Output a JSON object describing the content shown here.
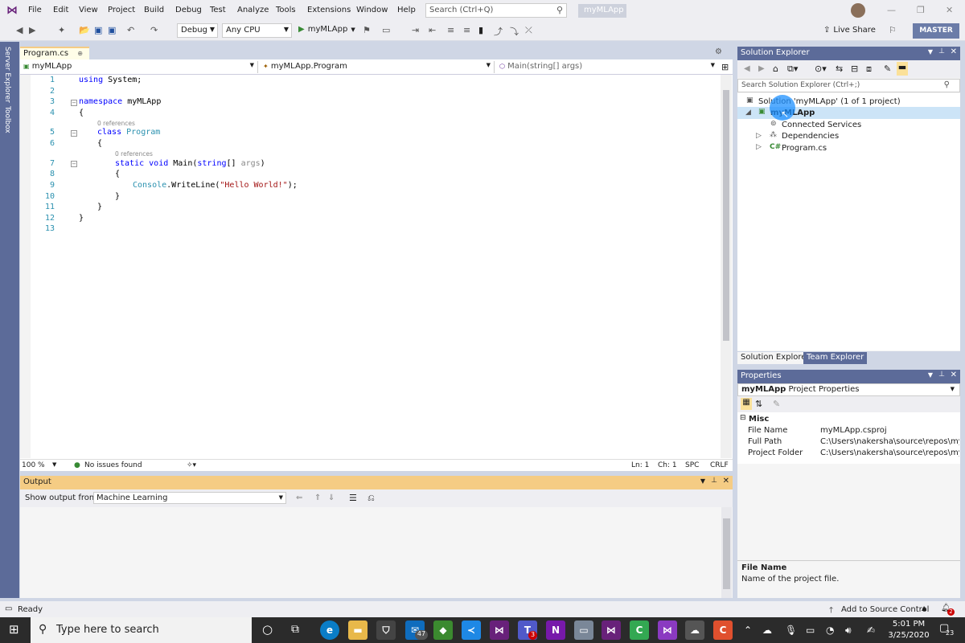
{
  "menu": {
    "items": [
      "File",
      "Edit",
      "View",
      "Project",
      "Build",
      "Debug",
      "Test",
      "Analyze",
      "Tools",
      "Extensions",
      "Window",
      "Help"
    ],
    "search_placeholder": "Search (Ctrl+Q)",
    "solution_name": "myMLApp"
  },
  "toolbar": {
    "configuration": "Debug",
    "platform": "Any CPU",
    "start_target": "myMLApp",
    "live_share": "Live Share",
    "master": "MASTER"
  },
  "left_strip": {
    "server_explorer": "Server Explorer",
    "toolbox": "Toolbox"
  },
  "editor": {
    "tab_title": "Program.cs",
    "nav_project": "myMLApp",
    "nav_type": "myMLApp.Program",
    "nav_member": "Main(string[] args)",
    "line_numbers": [
      "1",
      "2",
      "3",
      "4",
      "5",
      "6",
      "7",
      "8",
      "9",
      "10",
      "11",
      "12",
      "13"
    ],
    "references": "0 references",
    "zoom": "100 %",
    "issues": "No issues found",
    "ln": "Ln: 1",
    "ch": "Ch: 1",
    "spc": "SPC",
    "crlf": "CRLF",
    "code": {
      "kw_using": "using",
      "sys": " System;",
      "kw_namespace": "namespace",
      "ns_name": " myMLApp",
      "brace_open": "{",
      "brace_close": "}",
      "kw_class": "class",
      "class_name": " Program",
      "kw_static": "static",
      "kw_void": "void",
      "main": " Main(",
      "kw_string": "string",
      "args_open": "[] ",
      "args": "args",
      "paren": ")",
      "console": "Console",
      "writeline": ".WriteLine(",
      "hello": "\"Hello World!\"",
      "end": ");"
    }
  },
  "output": {
    "title": "Output",
    "show_from_label": "Show output from:",
    "source": "Machine Learning"
  },
  "solution_explorer": {
    "title": "Solution Explorer",
    "search_placeholder": "Search Solution Explorer (Ctrl+;)",
    "tree": {
      "solution": "Solution 'myMLApp' (1 of 1 project)",
      "project": "myMLApp",
      "connected": "Connected Services",
      "dependencies": "Dependencies",
      "program": "Program.cs"
    },
    "tab_solution": "Solution Explorer",
    "tab_team": "Team Explorer"
  },
  "properties": {
    "title": "Properties",
    "object_name": "myMLApp",
    "object_type": "Project Properties",
    "category": "Misc",
    "rows": [
      {
        "key": "File Name",
        "value": "myMLApp.csproj"
      },
      {
        "key": "Full Path",
        "value": "C:\\Users\\nakersha\\source\\repos\\myMLApp"
      },
      {
        "key": "Project Folder",
        "value": "C:\\Users\\nakersha\\source\\repos\\myMLApp"
      }
    ],
    "desc_title": "File Name",
    "desc_text": "Name of the project file."
  },
  "status": {
    "ready": "Ready",
    "source_control": "Add to Source Control",
    "notifications": "2"
  },
  "taskbar": {
    "search_placeholder": "Type here to search",
    "mail_badge": "47",
    "teams_badge": "3",
    "time": "5:01 PM",
    "date": "3/25/2020",
    "notif_count": "23"
  },
  "colors": {
    "accent": "#5c6b99",
    "active_tab": "#f5cc84",
    "vs_purple": "#68217a"
  }
}
